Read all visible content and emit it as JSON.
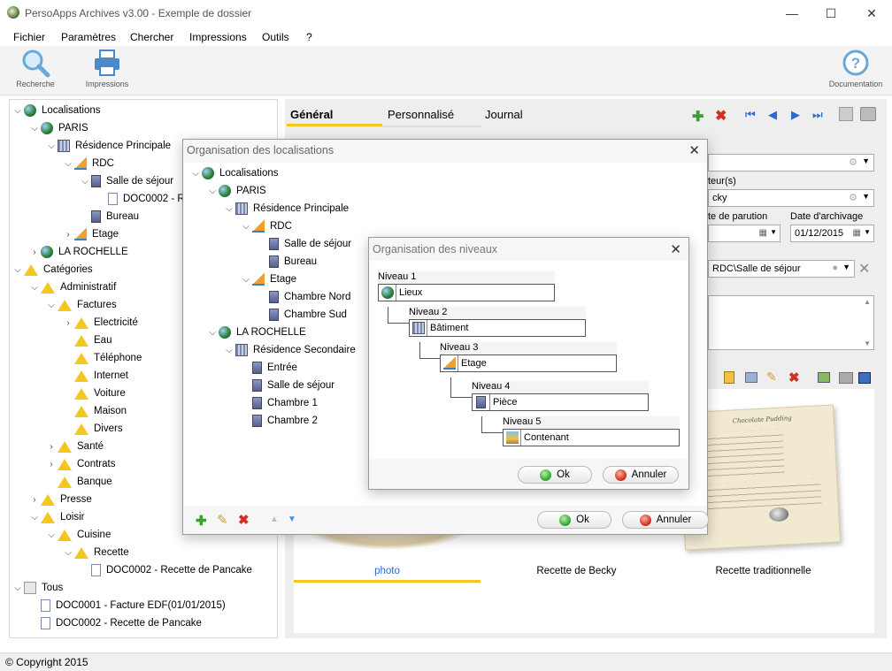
{
  "window": {
    "title": "PersoApps Archives v3.00 - Exemple de dossier",
    "minimize": "—",
    "maximize": "☐",
    "close": "✕"
  },
  "menu": [
    "Fichier",
    "Paramètres",
    "Chercher",
    "Impressions",
    "Outils",
    "?"
  ],
  "toolbar": {
    "search_label": "Recherche",
    "print_label": "Impressions",
    "doc_label": "Documentation"
  },
  "tree": {
    "rows": [
      {
        "label": "Localisations",
        "chev": "v",
        "icon": "globe-icon"
      },
      {
        "label": "PARIS",
        "chev": "v",
        "icon": "globe-icon"
      },
      {
        "label": "Résidence Principale",
        "chev": "v",
        "icon": "building-icon"
      },
      {
        "label": "RDC",
        "chev": "v",
        "icon": "stairs-icon"
      },
      {
        "label": "Salle de séjour",
        "chev": "v",
        "icon": "room-icon"
      },
      {
        "label": "DOC0002 - R",
        "chev": "",
        "icon": "document-icon"
      },
      {
        "label": "Bureau",
        "chev": "",
        "icon": "room-icon"
      },
      {
        "label": "Etage",
        "chev": ">",
        "icon": "stairs-icon"
      },
      {
        "label": "LA ROCHELLE",
        "chev": ">",
        "icon": "globe-icon"
      },
      {
        "label": "Catégories",
        "chev": "v",
        "icon": "category-icon"
      },
      {
        "label": "Administratif",
        "chev": "v",
        "icon": "category-icon"
      },
      {
        "label": "Factures",
        "chev": "v",
        "icon": "category-icon"
      },
      {
        "label": "Electricité",
        "chev": ">",
        "icon": "category-icon"
      },
      {
        "label": "Eau",
        "chev": "",
        "icon": "category-icon"
      },
      {
        "label": "Téléphone",
        "chev": "",
        "icon": "category-icon"
      },
      {
        "label": "Internet",
        "chev": "",
        "icon": "category-icon"
      },
      {
        "label": "Voiture",
        "chev": "",
        "icon": "category-icon"
      },
      {
        "label": "Maison",
        "chev": "",
        "icon": "category-icon"
      },
      {
        "label": "Divers",
        "chev": "",
        "icon": "category-icon"
      },
      {
        "label": "Santé",
        "chev": ">",
        "icon": "category-icon"
      },
      {
        "label": "Contrats",
        "chev": ">",
        "icon": "category-icon"
      },
      {
        "label": "Banque",
        "chev": "",
        "icon": "category-icon"
      },
      {
        "label": "Presse",
        "chev": ">",
        "icon": "category-icon"
      },
      {
        "label": "Loisir",
        "chev": "v",
        "icon": "category-icon"
      },
      {
        "label": "Cuisine",
        "chev": "v",
        "icon": "category-icon"
      },
      {
        "label": "Recette",
        "chev": "v",
        "icon": "category-icon"
      },
      {
        "label": "DOC0002 - Recette de Pancake",
        "chev": "",
        "icon": "document-icon"
      },
      {
        "label": "Tous",
        "chev": "v",
        "icon": "all-documents-icon"
      },
      {
        "label": "DOC0001 - Facture EDF(01/01/2015)",
        "chev": "",
        "icon": "document-icon"
      },
      {
        "label": "DOC0002 - Recette de Pancake",
        "chev": "",
        "icon": "document-icon"
      }
    ]
  },
  "tabs": [
    "Général",
    "Personnalisé",
    "Journal"
  ],
  "form": {
    "author_label": "teur(s)",
    "author_value": "cky",
    "parution_label": "te de parution",
    "archive_label": "Date d'archivage",
    "archive_value": "01/12/2015",
    "location_value": "RDC\\Salle de séjour"
  },
  "pictures": {
    "captions": [
      "photo",
      "Recette de Becky",
      "Recette traditionnelle"
    ],
    "recipe_title": "Chocolate Pudding"
  },
  "status": {
    "text": "© Copyright 2015"
  },
  "dialog_locations": {
    "title": "Organisation des localisations",
    "rows": [
      {
        "label": "Localisations",
        "chev": "v",
        "icon": "globe-icon"
      },
      {
        "label": "PARIS",
        "chev": "v",
        "icon": "globe-icon"
      },
      {
        "label": "Résidence Principale",
        "chev": "v",
        "icon": "building-icon"
      },
      {
        "label": "RDC",
        "chev": "v",
        "icon": "stairs-icon"
      },
      {
        "label": "Salle de séjour",
        "chev": "",
        "icon": "room-icon"
      },
      {
        "label": "Bureau",
        "chev": "",
        "icon": "room-icon"
      },
      {
        "label": "Etage",
        "chev": "v",
        "icon": "stairs-icon"
      },
      {
        "label": "Chambre Nord",
        "chev": "",
        "icon": "room-icon"
      },
      {
        "label": "Chambre Sud",
        "chev": "",
        "icon": "room-icon"
      },
      {
        "label": "LA ROCHELLE",
        "chev": "v",
        "icon": "globe-icon"
      },
      {
        "label": "Résidence Secondaire",
        "chev": "v",
        "icon": "building-icon"
      },
      {
        "label": "Entrée",
        "chev": "",
        "icon": "room-icon"
      },
      {
        "label": "Salle de séjour",
        "chev": "",
        "icon": "room-icon"
      },
      {
        "label": "Chambre 1",
        "chev": "",
        "icon": "room-icon"
      },
      {
        "label": "Chambre 2",
        "chev": "",
        "icon": "room-icon"
      }
    ],
    "ok": "Ok",
    "cancel": "Annuler"
  },
  "dialog_levels": {
    "title": "Organisation des niveaux",
    "levels": [
      {
        "label": "Niveau 1",
        "value": "Lieux"
      },
      {
        "label": "Niveau 2",
        "value": "Bâtiment"
      },
      {
        "label": "Niveau 3",
        "value": "Etage"
      },
      {
        "label": "Niveau 4",
        "value": "Pièce"
      },
      {
        "label": "Niveau 5",
        "value": "Contenant"
      }
    ],
    "ok": "Ok",
    "cancel": "Annuler"
  },
  "colors": {
    "accent": "#f2c820",
    "tab_blue": "#2a6ad0"
  }
}
